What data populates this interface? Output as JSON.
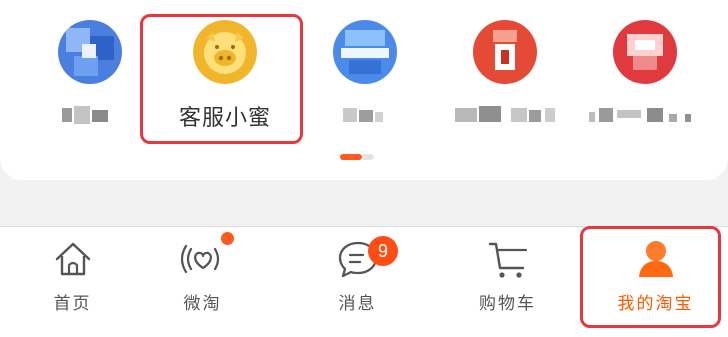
{
  "services": {
    "items": [
      {
        "name": "service-1",
        "label": "",
        "icon": "blurred-blue-icon",
        "color": "#4a7fe0"
      },
      {
        "name": "customer-service",
        "label": "客服小蜜",
        "icon": "piggy-mascot-icon",
        "color": "#f0b52a"
      },
      {
        "name": "service-3",
        "label": "",
        "icon": "blurred-blue-icon",
        "color": "#4b8ae8"
      },
      {
        "name": "service-4",
        "label": "",
        "icon": "blurred-red-icon",
        "color": "#e44a35"
      },
      {
        "name": "service-5",
        "label": "",
        "icon": "blurred-red-icon",
        "color": "#e03a3f"
      }
    ]
  },
  "tabbar": {
    "tabs": [
      {
        "name": "tab-home",
        "label": "首页",
        "icon": "home-icon"
      },
      {
        "name": "tab-weitao",
        "label": "微淘",
        "icon": "heart-signal-icon",
        "dot": true
      },
      {
        "name": "tab-messages",
        "label": "消息",
        "icon": "chat-bubble-icon",
        "badge": "9"
      },
      {
        "name": "tab-cart",
        "label": "购物车",
        "icon": "cart-icon"
      },
      {
        "name": "tab-my-taobao",
        "label": "我的淘宝",
        "icon": "person-icon",
        "active": true
      }
    ]
  },
  "colors": {
    "accent": "#ff5a00",
    "highlight": "#e5393f",
    "badge": "#ff4d16"
  }
}
